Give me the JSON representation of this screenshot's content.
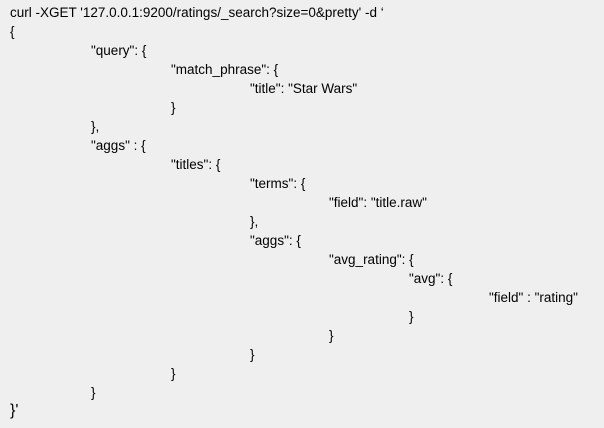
{
  "document": {
    "lines": [
      "curl -XGET '127.0.0.1:9200/ratings/_search?size=0&pretty' -d ‘",
      "{",
      "\"query\": {",
      "\"match_phrase\": {",
      "\"title\": \"Star Wars\"",
      "}",
      "},",
      "\"aggs\" : {",
      "\"titles\": {",
      "\"terms\": {",
      "\"field\": \"title.raw\"",
      "},",
      "\"aggs\": {",
      "\"avg_rating\": {",
      "\"avg\": {",
      "\"field\" : \"rating\"",
      "}",
      "}",
      "}",
      "}",
      "}",
      "}'"
    ]
  }
}
